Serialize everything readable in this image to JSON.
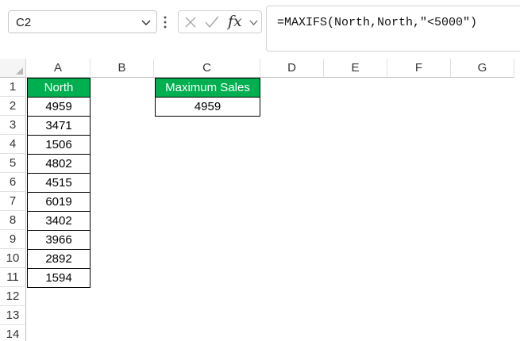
{
  "name_box": {
    "value": "C2"
  },
  "formula_bar": {
    "fx_label": "fx",
    "formula": "=MAXIFS(North,North,\"<5000\")"
  },
  "columns": [
    "A",
    "B",
    "C",
    "D",
    "E",
    "F",
    "G"
  ],
  "rows": [
    "1",
    "2",
    "3",
    "4",
    "5",
    "6",
    "7",
    "8",
    "9",
    "10",
    "11",
    "12",
    "13",
    "14"
  ],
  "north_table": {
    "header": "North",
    "values": [
      "4959",
      "3471",
      "1506",
      "4802",
      "4515",
      "6019",
      "3402",
      "3966",
      "2892",
      "1594"
    ]
  },
  "result_table": {
    "header": "Maximum Sales",
    "value": "4959"
  },
  "colors": {
    "header_green": "#00b050",
    "header_text": "#ffffff",
    "cell_border": "#000000"
  }
}
